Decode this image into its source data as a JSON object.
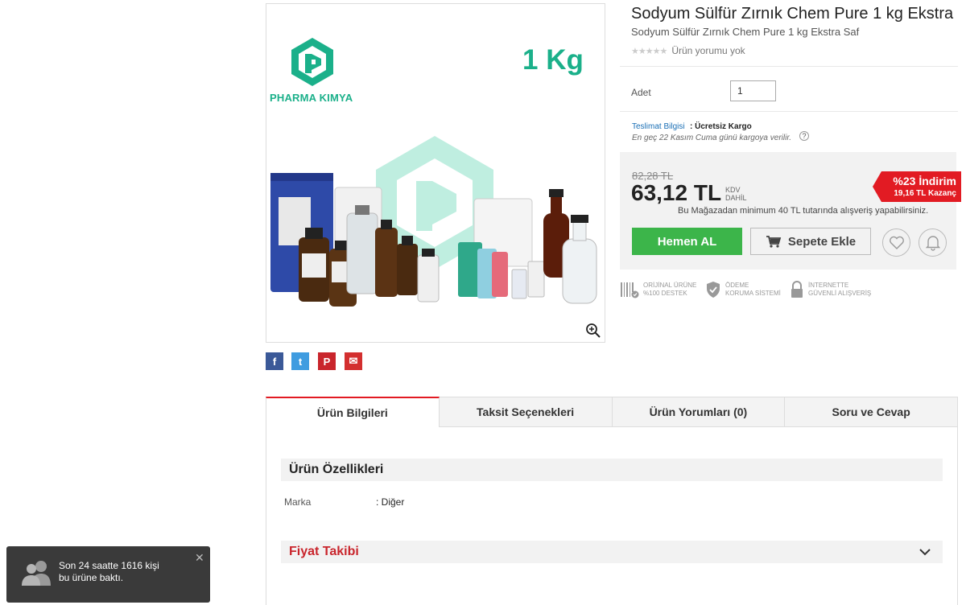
{
  "product": {
    "title": "Sodyum Sülfür Zırnık Chem Pure 1 kg Ekstra",
    "subtitle": "Sodyum Sülfür Zırnık Chem Pure 1 kg Ekstra Saf",
    "rating_text": "Ürün yorumu yok",
    "rating_stars": 0
  },
  "image": {
    "brand_name": "PHARMA KIMYA",
    "weight_label": "1 Kg",
    "brand_color": "#1bb08a"
  },
  "quantity": {
    "label": "Adet",
    "value": "1"
  },
  "delivery": {
    "label": "Teslimat Bilgisi",
    "value": ": Ücretsiz Kargo",
    "note": "En geç 22 Kasım Cuma günü kargoya verilir.",
    "help_icon": "?"
  },
  "price": {
    "old": "82,28 TL",
    "new": "63,12 TL",
    "tax_label": "KDV DAHİL",
    "discount_pct": "%23 İndirim",
    "discount_save": "19,16 TL Kazanç",
    "min_order_note": "Bu Mağazadan minimum 40 TL tutarında alışveriş yapabilirsiniz."
  },
  "buttons": {
    "buy_now": "Hemen AL",
    "add_to_cart": "Sepete Ekle"
  },
  "trust": [
    {
      "line1": "ORİJİNAL ÜRÜNE",
      "line2": "%100 DESTEK"
    },
    {
      "line1": "ÖDEME",
      "line2": "KORUMA SİSTEMİ"
    },
    {
      "line1": "İNTERNETTE",
      "line2": "GÜVENLİ ALIŞVERİŞ"
    }
  ],
  "tabs": [
    {
      "label": "Ürün Bilgileri",
      "active": true
    },
    {
      "label": "Taksit Seçenekleri",
      "active": false
    },
    {
      "label": "Ürün Yorumları (0)",
      "active": false
    },
    {
      "label": "Soru ve Cevap",
      "active": false
    }
  ],
  "features": {
    "header": "Ürün Özellikleri",
    "rows": [
      {
        "label": "Marka",
        "value": ": Diğer"
      }
    ]
  },
  "price_tracking": {
    "header": "Fiyat Takibi"
  },
  "toast": {
    "line1": "Son 24 saatte 1616 kişi",
    "line2": "bu ürüne baktı.",
    "close": "✕"
  },
  "share": {
    "facebook": "f",
    "twitter": "t",
    "pinterest": "P",
    "mail": "✉"
  },
  "colors": {
    "accent": "#e21b23",
    "buy": "#3cb54a",
    "link": "#1a6fb5"
  }
}
